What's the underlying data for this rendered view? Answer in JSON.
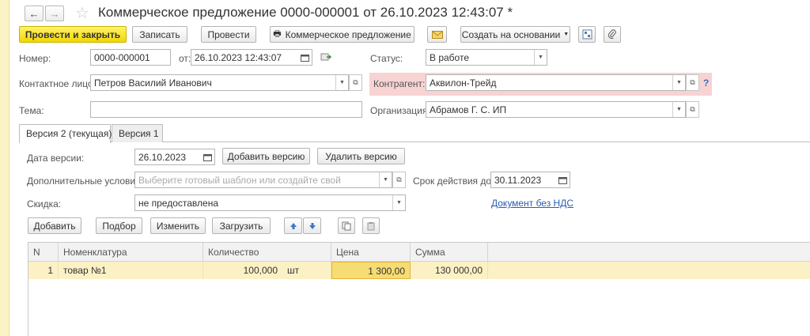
{
  "window": {
    "title": "Коммерческое предложение 0000-000001 от 26.10.2023 12:43:07 *"
  },
  "toolbar": {
    "post_close": "Провести и закрыть",
    "save": "Записать",
    "post": "Провести",
    "print": "Коммерческое предложение",
    "create_based": "Создать на основании"
  },
  "form": {
    "number_label": "Номер:",
    "number_value": "0000-000001",
    "from_label": "от:",
    "date_value": "26.10.2023 12:43:07",
    "status_label": "Статус:",
    "status_value": "В работе",
    "contact_label": "Контактное лицо:",
    "contact_value": "Петров Василий Иванович",
    "counterparty_label": "Контрагент:",
    "counterparty_value": "Аквилон-Трейд",
    "help": "?",
    "topic_label": "Тема:",
    "topic_value": "",
    "org_label": "Организация:",
    "org_value": "Абрамов Г. С. ИП"
  },
  "tabs": [
    {
      "label": "Версия 2 (текущая)",
      "active": true
    },
    {
      "label": "Версия 1",
      "active": false
    }
  ],
  "version": {
    "date_label": "Дата версии:",
    "date_value": "26.10.2023",
    "add_version": "Добавить версию",
    "delete_version": "Удалить версию",
    "conditions_label": "Дополнительные условия:",
    "conditions_placeholder": "Выберите готовый шаблон или создайте свой",
    "valid_label": "Срок действия до:",
    "valid_value": "30.11.2023",
    "discount_label": "Скидка:",
    "discount_value": "не предоставлена",
    "no_vat_link": "Документ без НДС"
  },
  "table_toolbar": {
    "add": "Добавить",
    "pick": "Подбор",
    "edit": "Изменить",
    "load": "Загрузить"
  },
  "table": {
    "headers": [
      "N",
      "Номенклатура",
      "Количество",
      "Цена",
      "Сумма"
    ],
    "rows": [
      {
        "n": "1",
        "item": "товар №1",
        "qty": "100,000",
        "unit": "шт",
        "price": "1 300,00",
        "sum": "130 000,00"
      }
    ]
  },
  "colors": {
    "accent_yellow": "#f2d700",
    "selected_row": "#fbf1c4",
    "error_highlight": "#f7d3d3",
    "link": "#2a5db0"
  }
}
